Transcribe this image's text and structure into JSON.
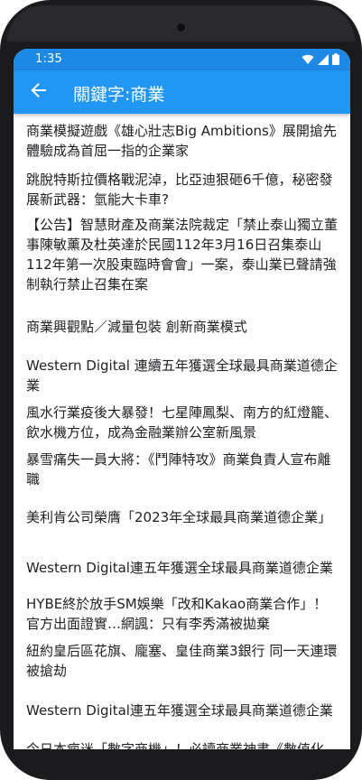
{
  "status_bar": {
    "time": "1:35",
    "icons": [
      "wifi-icon",
      "cellular-signal-icon",
      "battery-icon"
    ]
  },
  "app_bar": {
    "title": "關鍵字:商業",
    "back_icon": "arrow-back-icon",
    "color": "#2196f3",
    "status_color": "#1e88e5"
  },
  "articles": [
    {
      "title": "商業模擬遊戲《雄心壯志Big Ambitions》展開搶先體驗成為首屈一指的企業家"
    },
    {
      "title": "跳脫特斯拉價格戰泥淖，比亞迪狠砸6千億，秘密發展新武器：氫能大卡車?"
    },
    {
      "title": "【公告】智慧財產及商業法院裁定「禁止泰山獨立董事陳敏薰及杜英達於民國112年3月16日召集泰山112年第一次股東臨時會會」一案，泰山業已聲請強制執行禁止召集在案"
    },
    {
      "title": "商業興觀點／減量包裝 創新商業模式"
    },
    {
      "title": "Western Digital 連續五年獲選全球最具商業道德企業"
    },
    {
      "title": "風水行業疫後大暴發！七星陣鳳梨、南方的紅燈籠、飲水機方位，成為金融業辦公室新風景"
    },
    {
      "title": "暴雪痛失一員大將：《鬥陣特攻》商業負責人宣布離職"
    },
    {
      "title": "美利肯公司榮膺「2023年全球最具商業道德企業」"
    },
    {
      "title": "Western Digital連五年獲選全球最具商業道德企業"
    },
    {
      "title": "HYBE終於放手SM娛樂「改和Kakao商業合作」！官方出面證實…網諷：只有李秀滿被拋棄"
    },
    {
      "title": "紐約皇后區花旗、龐塞、皇佳商業3銀行 同一天連環被搶劫"
    },
    {
      "title": "Western Digital連五年獲選全球最具商業道德企業"
    },
    {
      "title": "今日本瘋迷「數字商機」！必讀商業神書《數值化"
    }
  ]
}
